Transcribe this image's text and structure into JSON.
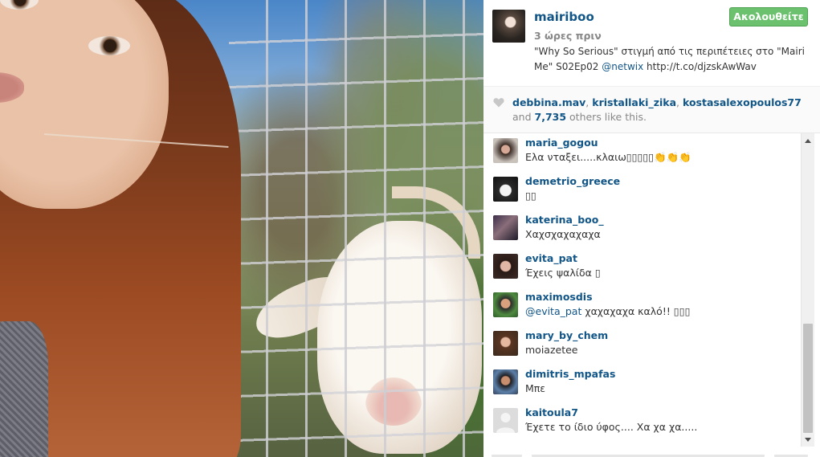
{
  "post": {
    "owner": "mairiboo",
    "time_ago": "3 ώρες πριν",
    "caption_text": "\"Why So Serious\" στιγμή από τις περιπέτειες στο \"Mairi Me\" S02Ep02 ",
    "caption_mention": "@netwix",
    "caption_link": " http://t.co/djzskAwWav",
    "follow_label": "Ακολουθείτε",
    "follow_color": "#6bc16d",
    "link_color": "#125688"
  },
  "likes": {
    "icon": "heart-icon",
    "users": [
      "debbina.mav",
      "kristallaki_zika",
      "kostasalexopoulos77"
    ],
    "sep1": ", ",
    "sep2": ", ",
    "and_word": " and ",
    "others_count": "7,735",
    "others_suffix": " others like this."
  },
  "comments": [
    {
      "user": "maria_gogou",
      "text": "Ελα νταξει.....κλαιω▯▯▯▯▯👏👏👏",
      "mention": ""
    },
    {
      "user": "demetrio_greece",
      "text": "▯▯",
      "mention": ""
    },
    {
      "user": "katerina_boo_",
      "text": "Χαχσχαχαχαχα",
      "mention": ""
    },
    {
      "user": "evita_pat",
      "text": "Έχεις ψαλίδα ▯",
      "mention": ""
    },
    {
      "user": "maximosdis",
      "text": " χαχαχαχα καλό!! ▯▯▯",
      "mention": "@evita_pat"
    },
    {
      "user": "mary_by_chem",
      "text": "moiazetee",
      "mention": ""
    },
    {
      "user": "dimitris_mpafas",
      "text": "Μπε",
      "mention": ""
    },
    {
      "user": "kaitoula7",
      "text": "Έχετε το ίδιο ύφος.... Χα χα χα.....",
      "mention": ""
    }
  ]
}
